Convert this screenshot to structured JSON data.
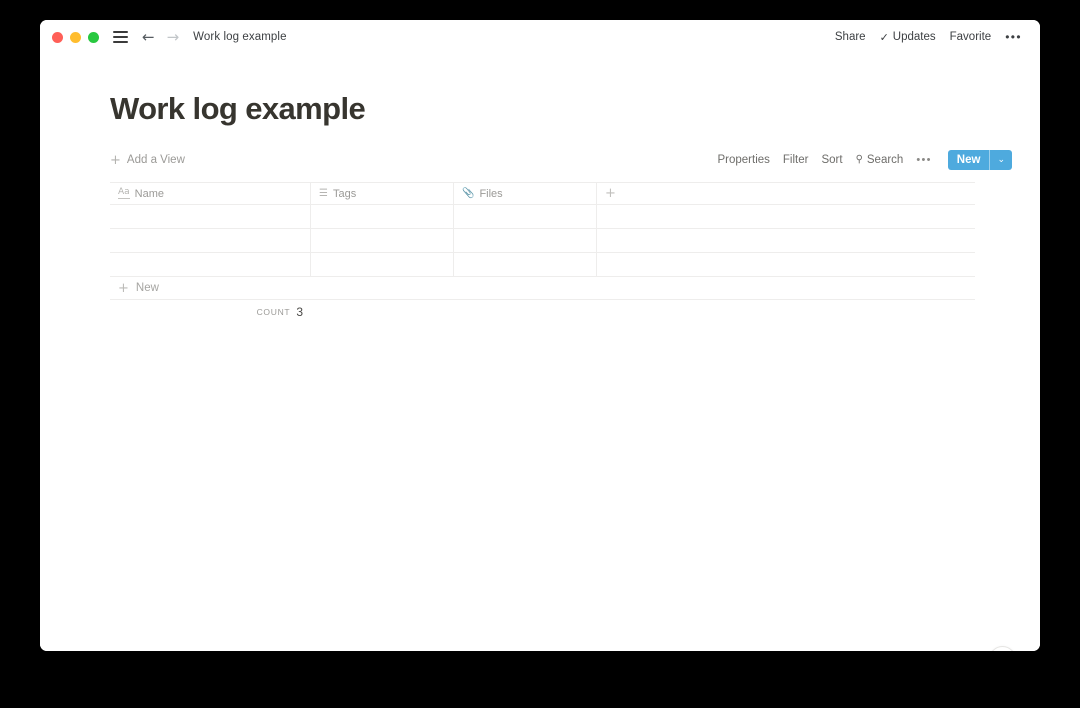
{
  "window": {
    "traffic_lights": [
      {
        "name": "close",
        "color": "#ff5f57"
      },
      {
        "name": "minimize",
        "color": "#ffbd2e"
      },
      {
        "name": "maximize",
        "color": "#28c840"
      }
    ],
    "menu_icon": "hamburger-menu-icon",
    "back_arrow": "←",
    "forward_arrow": "→",
    "title": "Work log example",
    "right_actions": {
      "share": "Share",
      "updates": "Updates",
      "updates_check": "✓",
      "favorite": "Favorite",
      "more": "•••"
    }
  },
  "page": {
    "title": "Work log example"
  },
  "view_bar": {
    "add_view_plus": "+",
    "add_view_label": "Add a View",
    "actions": {
      "properties": "Properties",
      "filter": "Filter",
      "sort": "Sort",
      "search_icon": "⚲",
      "search": "Search",
      "more": "•••"
    },
    "new_button": {
      "label": "New",
      "caret": "⌄",
      "color": "#4eaade"
    }
  },
  "table": {
    "columns": [
      {
        "key": "name",
        "label": "Name",
        "icon": "Aa",
        "icon_name": "text-type-icon"
      },
      {
        "key": "tags",
        "label": "Tags",
        "icon": "☰",
        "icon_name": "multiselect-icon"
      },
      {
        "key": "files",
        "label": "Files",
        "icon": "📎",
        "icon_name": "paperclip-icon"
      }
    ],
    "add_column_icon": "+",
    "rows": [
      {
        "name": "",
        "tags": "",
        "files": ""
      },
      {
        "name": "",
        "tags": "",
        "files": ""
      },
      {
        "name": "",
        "tags": "",
        "files": ""
      }
    ],
    "new_row": {
      "plus": "+",
      "label": "New"
    },
    "footer": {
      "count_label": "Count",
      "count_value": "3"
    }
  },
  "help": {
    "glyph": "?"
  }
}
